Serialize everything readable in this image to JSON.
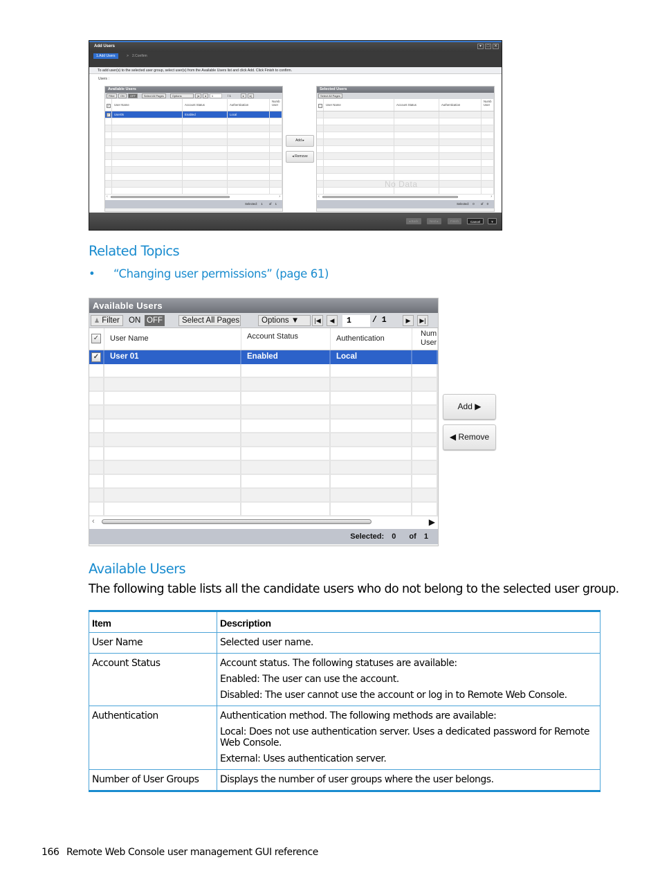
{
  "dialog": {
    "title": "Add Users",
    "window_buttons": [
      "▾",
      "□",
      "✕"
    ],
    "steps": [
      "1.Add Users",
      "2.Confirm"
    ],
    "step_separator": ">",
    "instruction": "To add user(s) to the selected user group, select user(s) from the Available Users list and click Add. Click Finish to confirm.",
    "users_label": "Users :",
    "available": {
      "title": "Available Users",
      "filter_label": "Filter",
      "on_label": "ON",
      "off_label": "OFF",
      "select_all_label": "Select All Pages",
      "options_label": "Options",
      "page_value": "1",
      "page_total": "/ 1",
      "columns": [
        "User Name",
        "Account Status",
        "Authentication",
        "Numb User"
      ],
      "rows": [
        {
          "user_name": "User05",
          "account_status": "Enabled",
          "authentication": "Local",
          "selected": true
        }
      ],
      "selected_label": "Selected:",
      "selected_count": "1",
      "of_label": "of",
      "total_count": "1"
    },
    "selected": {
      "title": "Selected Users",
      "select_all_label": "Select All Pages",
      "columns": [
        "User Name",
        "Account Status",
        "Authentication",
        "Numb User"
      ],
      "empty_text": "No Data",
      "selected_label": "Selected:",
      "selected_count": "0",
      "of_label": "of",
      "total_count": "0"
    },
    "add_label": "Add",
    "remove_label": "Remove",
    "footer_buttons": {
      "back": "Back",
      "next": "Next",
      "finish": "Finish",
      "cancel": "Cancel",
      "help": "?"
    }
  },
  "related_topics": {
    "heading": "Related Topics",
    "bullet": "•",
    "link": "“Changing user permissions” (page 61)"
  },
  "panel": {
    "title": "Available Users",
    "filter_label": "Filter",
    "on_label": "ON",
    "off_label": "OFF",
    "select_all_label": "Select All Pages",
    "options_label": "Options",
    "page_value": "1",
    "page_total": "/ 1",
    "columns": [
      "User Name",
      "Account Status",
      "Authentication",
      "Numb User"
    ],
    "rows": [
      {
        "user_name": "User 01",
        "account_status": "Enabled",
        "authentication": "Local",
        "selected": true
      }
    ],
    "selected_label": "Selected:",
    "selected_count": "0",
    "of_label": "of",
    "total_count": "1",
    "add_label": "Add",
    "remove_label": "Remove"
  },
  "section": {
    "heading": "Available Users",
    "intro": "The following table lists all the candidate users who do not belong to the selected user group."
  },
  "desc_table": {
    "headers": [
      "Item",
      "Description"
    ],
    "rows": [
      {
        "item": "User Name",
        "desc": [
          "Selected user name."
        ]
      },
      {
        "item": "Account Status",
        "desc": [
          "Account status. The following statuses are available:",
          "Enabled: The user can use the account.",
          "Disabled: The user cannot use the account or log in to Remote Web Console."
        ]
      },
      {
        "item": "Authentication",
        "desc": [
          "Authentication method. The following methods are available:",
          "Local: Does not use authentication server. Uses a dedicated password for Remote Web Console.",
          "External: Uses authentication server."
        ]
      },
      {
        "item": "Number of User Groups",
        "desc": [
          "Displays the number of user groups where the user belongs."
        ]
      }
    ]
  },
  "page_footer": {
    "page_number": "166",
    "text": "Remote Web Console user management GUI reference"
  }
}
